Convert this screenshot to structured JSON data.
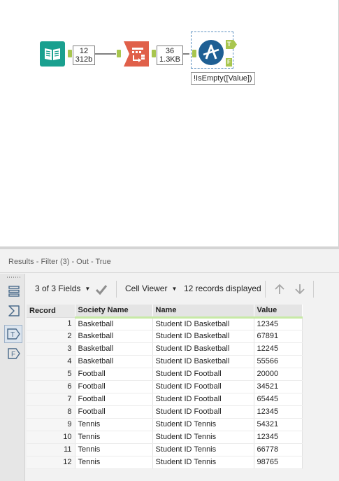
{
  "workflow": {
    "connection1": {
      "records": "12",
      "size": "312b"
    },
    "connection2": {
      "records": "36",
      "size": "1.3KB"
    },
    "filter_annotation": "!IsEmpty([Value])",
    "filter_true_anchor": "T",
    "filter_false_anchor": "F"
  },
  "results": {
    "title": "Results - Filter (3) - Out - True",
    "toolbar": {
      "fields_label": "3 of 3 Fields",
      "viewer_label": "Cell Viewer",
      "records_label": "12 records displayed"
    },
    "columns": [
      "Record",
      "Society Name",
      "Name",
      "Value"
    ],
    "rows": [
      [
        "1",
        "Basketball",
        "Student ID Basketball",
        "12345"
      ],
      [
        "2",
        "Basketball",
        "Student ID Basketball",
        "67891"
      ],
      [
        "3",
        "Basketball",
        "Student ID Basketball",
        "12245"
      ],
      [
        "4",
        "Basketball",
        "Student ID Basketball",
        "55566"
      ],
      [
        "5",
        "Football",
        "Student ID Football",
        "20000"
      ],
      [
        "6",
        "Football",
        "Student ID Football",
        "34521"
      ],
      [
        "7",
        "Football",
        "Student ID Football",
        "65445"
      ],
      [
        "8",
        "Football",
        "Student ID Football",
        "12345"
      ],
      [
        "9",
        "Tennis",
        "Student ID Tennis",
        "54321"
      ],
      [
        "10",
        "Tennis",
        "Student ID Tennis",
        "12345"
      ],
      [
        "11",
        "Tennis",
        "Student ID Tennis",
        "66778"
      ],
      [
        "12",
        "Tennis",
        "Student ID Tennis",
        "98765"
      ]
    ],
    "rail": {
      "true_anchor": "T",
      "false_anchor": "F"
    }
  },
  "colors": {
    "input_tool": "#1aa08f",
    "transpose_tool": "#e0604a",
    "filter_tool": "#1e5f94",
    "anchor": "#a8c64f",
    "header_underline": "#c7e9a6"
  },
  "icons": [
    "book-icon",
    "transpose-icon",
    "filter-icon",
    "records-list-icon",
    "sum-icon",
    "check-icon",
    "up-arrow-icon",
    "down-arrow-icon"
  ]
}
